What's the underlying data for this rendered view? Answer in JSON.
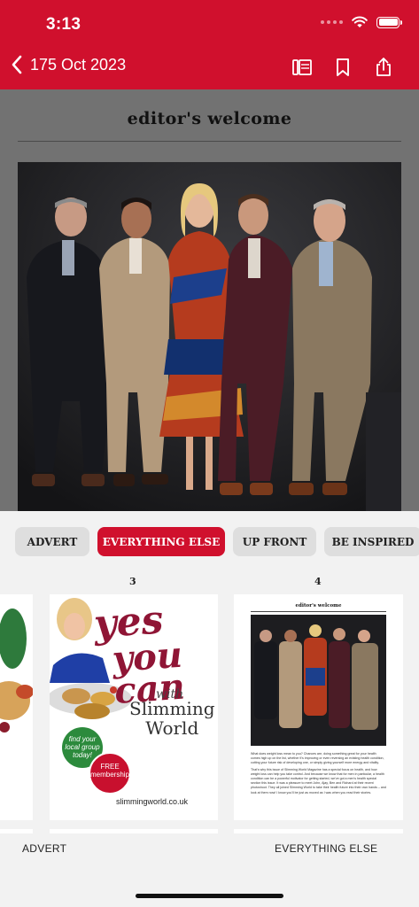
{
  "status_bar": {
    "time": "3:13"
  },
  "nav": {
    "back_label": "175 Oct 2023"
  },
  "viewer": {
    "page_heading": "editor's welcome"
  },
  "tabs": [
    {
      "label": "ADVERT",
      "active": false
    },
    {
      "label": "EVERYTHING ELSE",
      "active": true
    },
    {
      "label": "UP FRONT",
      "active": false
    },
    {
      "label": "BE INSPIRED",
      "active": false
    }
  ],
  "thumbnails": [
    {
      "page_number": "3",
      "section": "ADVERT",
      "ad": {
        "line1": "yes",
        "line2": "you can",
        "with": "with",
        "brand1": "Slimming",
        "brand2": "World",
        "badge_green": "find your local group today!",
        "badge_red": "FREE membership",
        "url": "slimmingworld.co.uk"
      }
    },
    {
      "page_number": "4",
      "section": "EVERYTHING ELSE",
      "mini_heading": "editor's welcome",
      "mini_para1": "What does weight loss mean to you? Chances are, doing something great for your health comes high up on the list, whether it's improving or even reversing an existing health condition, cutting your future risk of developing one, or simply giving yourself more energy and vitality.",
      "mini_para2": "That's why this issue of Slimming World Magazine has a special focus on health, and how weight loss can help you take control. And because we know that for men in particular, a health condition can be a powerful motivator for getting started, we've got a men's health special section this issue. It was a pleasure to meet John, Ajay, Ben and Richard at their recent photoshoot. They all joined Slimming World to take their health future into their own hands – and look at them now! I know you'll be just as moved as I was when you read their stories."
    }
  ],
  "colors": {
    "brand_red": "#d0102d",
    "ad_maroon": "#8f1535"
  }
}
